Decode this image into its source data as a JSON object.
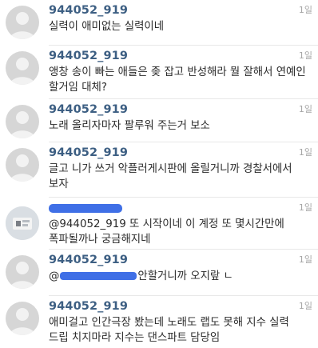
{
  "comments": [
    {
      "username": "944052_919",
      "time": "1일",
      "text": "실력이 애미없는 실력이네",
      "avatar": "default-avatar"
    },
    {
      "username": "944052_919",
      "time": "1일",
      "text": "앵창 송이 빠는 애들은 좆 잡고 반성해라 뭘 잘해서 연예인 할거임 대체?",
      "avatar": "default-avatar"
    },
    {
      "username": "944052_919",
      "time": "1일",
      "text": "노래 올리자마자 팔루워 주는거 보소",
      "avatar": "default-avatar"
    },
    {
      "username": "944052_919",
      "time": "1일",
      "text": "글고 니가 쓰거 악플러게시판에 올릴거니까 경찰서에서 보자",
      "avatar": "default-avatar"
    },
    {
      "username": "",
      "time": "1일",
      "text": "@944052_919 또 시작이네 이 계정 또 몇시간만에 폭파될까나 궁금해지네",
      "avatar": "profile-photo",
      "username_redacted": true
    },
    {
      "username": "944052_919",
      "time": "1일",
      "text_prefix": "@",
      "text_suffix": "안할거니까 오지랖 ㄴ",
      "avatar": "default-avatar",
      "mention_redacted": true
    },
    {
      "username": "944052_919",
      "time": "1일",
      "text": "애미걸고 인간극장 봤는데 노래도 랩도 못해 지수 실력 드립 치지마라 지수는 댄스파트 담당임",
      "avatar": "default-avatar"
    }
  ],
  "colors": {
    "username": "#3d5f83",
    "text": "#2a2a2a",
    "time": "#a6a6a6",
    "redaction": "#3f6fe6",
    "avatar_bg": "#d6d6d6"
  }
}
